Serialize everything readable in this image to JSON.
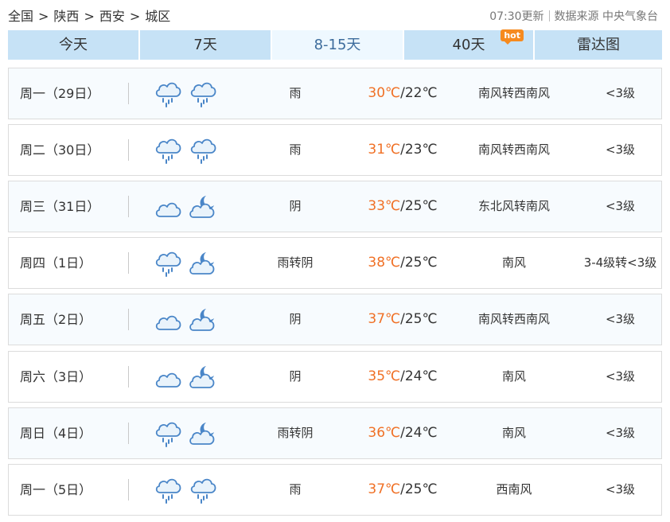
{
  "breadcrumb": {
    "items": [
      "全国",
      "陕西",
      "西安",
      "城区"
    ],
    "separator": ">"
  },
  "meta": {
    "updated": "07:30更新",
    "source": "数据来源 中央气象台"
  },
  "tabs": [
    {
      "label": "今天",
      "active": false
    },
    {
      "label": "7天",
      "active": false
    },
    {
      "label": "8-15天",
      "active": true
    },
    {
      "label": "40天",
      "active": false,
      "badge": "hot"
    },
    {
      "label": "雷达图",
      "active": false
    }
  ],
  "colors": {
    "high_temp": "#f07025",
    "active_tab_text": "#3d6c9c",
    "tab_bg": "#c6e2f6",
    "icon_blue": "#4a86c8"
  },
  "forecast": [
    {
      "day": "周一（29日）",
      "icon_day": "rain-icon",
      "icon_night": "rain-icon",
      "desc": "雨",
      "high": "30℃",
      "low": "/22℃",
      "wind": "南风转西南风",
      "level": "<3级"
    },
    {
      "day": "周二（30日）",
      "icon_day": "rain-icon",
      "icon_night": "rain-icon",
      "desc": "雨",
      "high": "31℃",
      "low": "/23℃",
      "wind": "南风转西南风",
      "level": "<3级"
    },
    {
      "day": "周三（31日）",
      "icon_day": "cloud-icon",
      "icon_night": "cloud-moon-icon",
      "desc": "阴",
      "high": "33℃",
      "low": "/25℃",
      "wind": "东北风转南风",
      "level": "<3级"
    },
    {
      "day": "周四（1日）",
      "icon_day": "rain-icon",
      "icon_night": "cloud-moon-icon",
      "desc": "雨转阴",
      "high": "38℃",
      "low": "/25℃",
      "wind": "南风",
      "level": "3-4级转<3级"
    },
    {
      "day": "周五（2日）",
      "icon_day": "cloud-icon",
      "icon_night": "cloud-moon-icon",
      "desc": "阴",
      "high": "37℃",
      "low": "/25℃",
      "wind": "南风转西南风",
      "level": "<3级"
    },
    {
      "day": "周六（3日）",
      "icon_day": "cloud-icon",
      "icon_night": "cloud-moon-icon",
      "desc": "阴",
      "high": "35℃",
      "low": "/24℃",
      "wind": "南风",
      "level": "<3级"
    },
    {
      "day": "周日（4日）",
      "icon_day": "rain-icon",
      "icon_night": "cloud-moon-icon",
      "desc": "雨转阴",
      "high": "36℃",
      "low": "/24℃",
      "wind": "南风",
      "level": "<3级"
    },
    {
      "day": "周一（5日）",
      "icon_day": "rain-icon",
      "icon_night": "rain-icon",
      "desc": "雨",
      "high": "37℃",
      "low": "/25℃",
      "wind": "西南风",
      "level": "<3级"
    }
  ]
}
